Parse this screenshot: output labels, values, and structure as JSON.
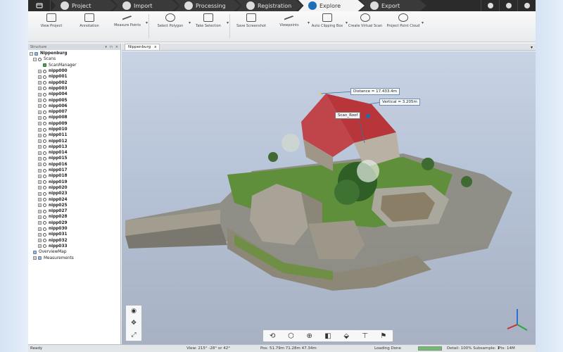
{
  "workflow_tabs": [
    {
      "label": "Project",
      "active": false,
      "icon": "folder-icon"
    },
    {
      "label": "Import",
      "active": false,
      "icon": "import-icon"
    },
    {
      "label": "Processing",
      "active": false,
      "icon": "filter-icon"
    },
    {
      "label": "Registration",
      "active": false,
      "icon": "registration-icon"
    },
    {
      "label": "Explore",
      "active": true,
      "icon": "explore-icon"
    },
    {
      "label": "Export",
      "active": false,
      "icon": "export-icon"
    }
  ],
  "ribbon": [
    {
      "label": "View Project",
      "icon": "cube-icon",
      "dropdown": false
    },
    {
      "label": "Annotation",
      "icon": "annotation-icon",
      "dropdown": false
    },
    {
      "label": "Measure Points",
      "icon": "measure-icon",
      "dropdown": true
    },
    {
      "label": "Select Polygon",
      "icon": "polygon-icon",
      "dropdown": true
    },
    {
      "label": "Take Selection",
      "icon": "selection-icon",
      "dropdown": true
    },
    {
      "label": "Save Screenshot",
      "icon": "screenshot-icon",
      "dropdown": false
    },
    {
      "label": "Viewpoints",
      "icon": "viewpoints-icon",
      "dropdown": true
    },
    {
      "label": "Auto Clipping Box",
      "icon": "clipping-box-icon",
      "dropdown": true
    },
    {
      "label": "Create Virtual Scan",
      "icon": "virtual-scan-icon",
      "dropdown": false
    },
    {
      "label": "Project Point Cloud",
      "icon": "point-cloud-icon",
      "dropdown": true
    }
  ],
  "panel": {
    "title": "Structure",
    "tree": {
      "root": "Nippenburg",
      "scans_label": "Scans",
      "scan_manager": "ScanManager",
      "scans": [
        "nipp000",
        "nipp001",
        "nipp002",
        "nipp003",
        "nipp004",
        "nipp005",
        "nipp006",
        "nipp007",
        "nipp008",
        "nipp009",
        "nipp010",
        "nipp011",
        "nipp012",
        "nipp013",
        "nipp014",
        "nipp015",
        "nipp016",
        "nipp017",
        "nipp018",
        "nipp019",
        "nipp020",
        "nipp023",
        "nipp024",
        "nipp025",
        "nipp027",
        "nipp028",
        "nipp029",
        "nipp030",
        "nipp031",
        "nipp032",
        "nipp033"
      ],
      "overview_map": "OverviewMap",
      "measurements": "Measurements"
    }
  },
  "document_tab": {
    "label": "Nippenburg",
    "close": "x"
  },
  "viewport": {
    "annotations": {
      "distance": "Distance = 17.433.4m",
      "vertical": "Vertical = 3.205m",
      "scan_label": "Scan_Roof"
    }
  },
  "status": {
    "ready": "Ready",
    "view": "View: 215° -28° or 42°",
    "pos": "Pos: 51.79m 71.28m 47.34m",
    "loading": "Loading Done",
    "detail": "Detail: 100%  Subsample: 1",
    "pts": "Pts: 14M",
    "progress": 1.0
  },
  "colors": {
    "active_tab_icon": "#1d6fb8",
    "roof": "#b8353a",
    "grass": "#5f8f3a",
    "stone": "#a59f93"
  }
}
